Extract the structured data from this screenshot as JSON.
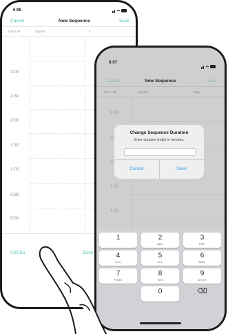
{
  "back_phone": {
    "status": {
      "time": "6:06",
      "icons": "signal-wifi-battery"
    },
    "nav": {
      "cancel": "Cancel",
      "title": "New Sequence",
      "save": "Save"
    },
    "columns": [
      "Time Left",
      "Signals",
      "F"
    ],
    "times": [
      "3:00",
      "2:30",
      "2:00",
      "1:30",
      "1:00",
      "0:30",
      "0:00"
    ],
    "bottom": {
      "left": "3:00 Du",
      "right": "Zoom"
    }
  },
  "front_phone": {
    "status": {
      "time": "6:07",
      "icons": "signal-wifi-battery"
    },
    "nav": {
      "cancel": "Cancel",
      "title": "New Sequence",
      "save": "Save"
    },
    "columns": [
      "Time Left",
      "Signals",
      "Flags"
    ],
    "times": [
      "3:00",
      "2:3",
      "2:0",
      "1:30",
      "1:00"
    ],
    "dialog": {
      "title": "Change Sequence Duration",
      "message": "Enter duration length in minutes.",
      "input_value": "",
      "cancel": "Cancel",
      "save": "Save"
    },
    "keypad": [
      {
        "num": "1",
        "letters": ""
      },
      {
        "num": "2",
        "letters": "ABC"
      },
      {
        "num": "3",
        "letters": "DEF"
      },
      {
        "num": "4",
        "letters": "GHI"
      },
      {
        "num": "5",
        "letters": "JKL"
      },
      {
        "num": "6",
        "letters": "MNO"
      },
      {
        "num": "7",
        "letters": "PQRS"
      },
      {
        "num": "8",
        "letters": "TUV"
      },
      {
        "num": "9",
        "letters": "WXYZ"
      },
      {
        "num": "",
        "letters": ""
      },
      {
        "num": "0",
        "letters": ""
      },
      {
        "num": "⌫",
        "letters": ""
      }
    ]
  },
  "colors": {
    "accent": "#46c4b4",
    "dialog_button": "#2f9fe0",
    "dim": "#cfcfcf",
    "keypad_bg": "#d0d2d6"
  }
}
